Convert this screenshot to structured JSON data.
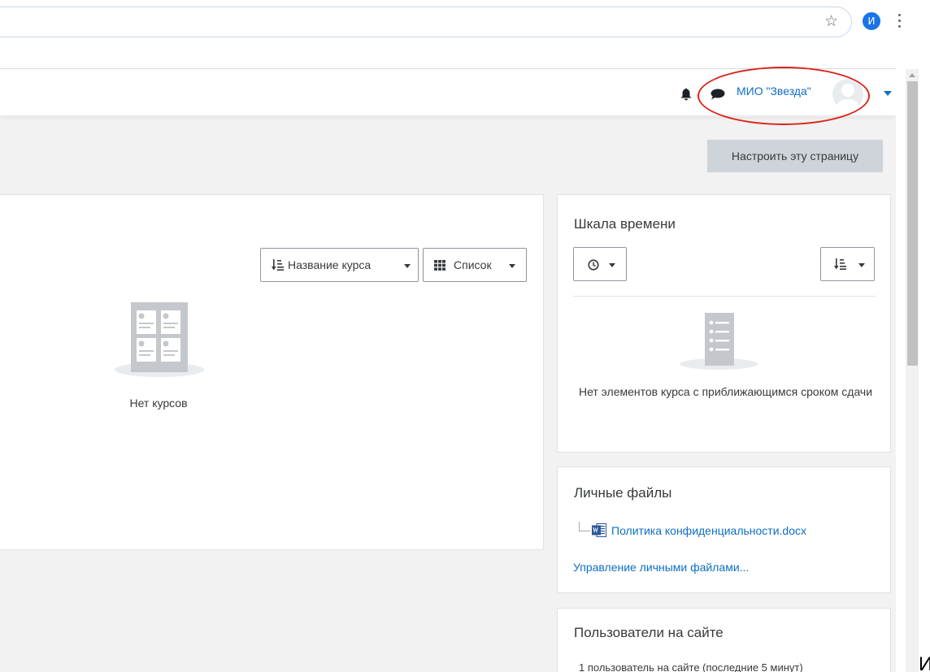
{
  "browser": {
    "profile_initial": "И",
    "star_icon": "☆",
    "menu_icon": "kebab-vertical-icon"
  },
  "navbar": {
    "user_name": "МИО \"Звезда\"",
    "icons": [
      "bell-icon",
      "chat-icon",
      "avatar",
      "chevron-down-icon"
    ]
  },
  "page": {
    "customize_button": "Настроить эту страницу"
  },
  "courses": {
    "sort_button": "Название курса",
    "view_button": "Список",
    "empty_text": "Нет курсов"
  },
  "timeline": {
    "title": "Шкала времени",
    "empty_text": "Нет элементов курса с приближающимся сроком сдачи"
  },
  "private_files": {
    "title": "Личные файлы",
    "file_name": "Политика конфиденциальности.docx",
    "manage_link": "Управление личными файлами..."
  },
  "online_users": {
    "title": "Пользователи на сайте",
    "summary": "1 пользователь на сайте (последние 5 минут)"
  },
  "edge_text": "И",
  "colors": {
    "link": "#0f6fc5",
    "highlight": "#d9251d",
    "button_gray": "#ced4da",
    "page_background": "#f2f2f2"
  }
}
